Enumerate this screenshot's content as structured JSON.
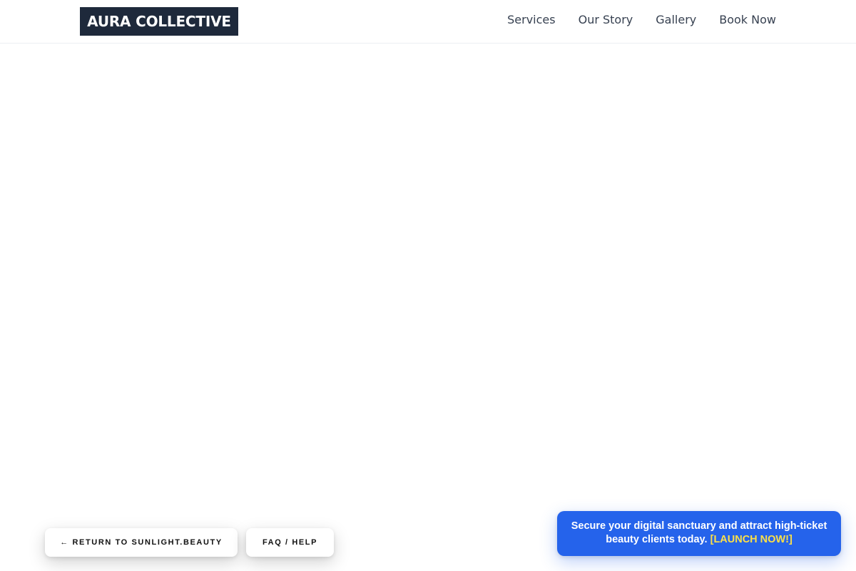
{
  "header": {
    "logo_text": "AURA COLLECTIVE",
    "nav": [
      {
        "label": "Services"
      },
      {
        "label": "Our Story"
      },
      {
        "label": "Gallery"
      },
      {
        "label": "Book Now"
      }
    ]
  },
  "footer_buttons": {
    "return_label": "← RETURN TO SUNLIGHT.BEAUTY",
    "faq_label": "FAQ / HELP"
  },
  "promo": {
    "text": "Secure your digital sanctuary and attract high-ticket beauty clients today.",
    "cta": "[LAUNCH NOW!]"
  },
  "colors": {
    "logo_bg": "#1e293b",
    "promo_bg": "#2563eb",
    "promo_cta": "#fde047",
    "nav_text": "#374151"
  }
}
